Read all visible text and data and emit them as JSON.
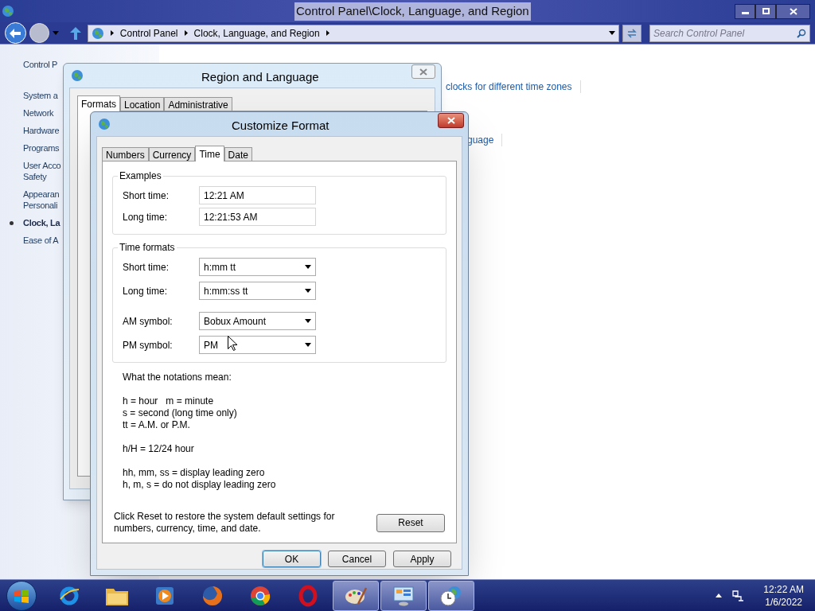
{
  "explorer": {
    "title": "Control Panel\\Clock, Language, and Region",
    "breadcrumbs": [
      "Control Panel",
      "Clock, Language, and Region"
    ],
    "search": {
      "placeholder": "Search Control Panel"
    },
    "nav": [
      {
        "label": "Control P",
        "selected": false
      },
      {
        "label": "System a",
        "selected": false
      },
      {
        "label": "Network",
        "selected": false
      },
      {
        "label": "Hardware",
        "selected": false
      },
      {
        "label": "Programs",
        "selected": false
      },
      {
        "label": "User Acco\nSafety",
        "selected": false
      },
      {
        "label": "Appearan\nPersonali",
        "selected": false
      },
      {
        "label": "Clock, La",
        "selected": true
      },
      {
        "label": "Ease of A",
        "selected": false
      }
    ],
    "links": [
      "clocks for different time zones",
      "guage"
    ]
  },
  "region_dialog": {
    "title": "Region and Language",
    "tabs": [
      {
        "label": "Formats",
        "selected": true
      },
      {
        "label": "Location",
        "selected": false
      },
      {
        "label": "Administrative",
        "selected": false
      }
    ]
  },
  "customize_dialog": {
    "title": "Customize Format",
    "tabs": [
      {
        "label": "Numbers",
        "selected": false
      },
      {
        "label": "Currency",
        "selected": false
      },
      {
        "label": "Time",
        "selected": true
      },
      {
        "label": "Date",
        "selected": false
      }
    ],
    "examples": {
      "title": "Examples",
      "rows": [
        {
          "label": "Short time:",
          "value": "12:21 AM"
        },
        {
          "label": "Long time:",
          "value": "12:21:53 AM"
        }
      ]
    },
    "time_formats": {
      "title": "Time formats",
      "rows": [
        {
          "label": "Short time:",
          "value": "h:mm tt"
        },
        {
          "label": "Long time:",
          "value": "h:mm:ss tt"
        },
        {
          "label": "AM symbol:",
          "value": "Bobux Amount"
        },
        {
          "label": "PM symbol:",
          "value": "PM"
        }
      ]
    },
    "notes": [
      [
        "What the notations mean:"
      ],
      [
        "h = hour   m = minute",
        "s = second (long time only)",
        "tt = A.M. or P.M."
      ],
      [
        "h/H = 12/24 hour"
      ],
      [
        "hh, mm, ss = display leading zero",
        "h, m, s = do not display leading zero"
      ]
    ],
    "reset_text": "Click Reset to restore the system default settings for numbers, currency, time, and date.",
    "reset_button": "Reset",
    "buttons": [
      {
        "label": "OK",
        "default": true
      },
      {
        "label": "Cancel",
        "default": false
      },
      {
        "label": "Apply",
        "default": false
      }
    ]
  },
  "taskbar": {
    "apps": [
      {
        "kind": "ie",
        "running": false
      },
      {
        "kind": "folder",
        "running": false
      },
      {
        "kind": "media",
        "running": false
      },
      {
        "kind": "firefox",
        "running": false
      },
      {
        "kind": "chrome",
        "running": false
      },
      {
        "kind": "opera",
        "running": false
      },
      {
        "kind": "paint",
        "running": true
      },
      {
        "kind": "control",
        "running": true
      },
      {
        "kind": "clock",
        "running": true
      }
    ],
    "time": "12:22 AM",
    "date": "1/6/2022"
  }
}
